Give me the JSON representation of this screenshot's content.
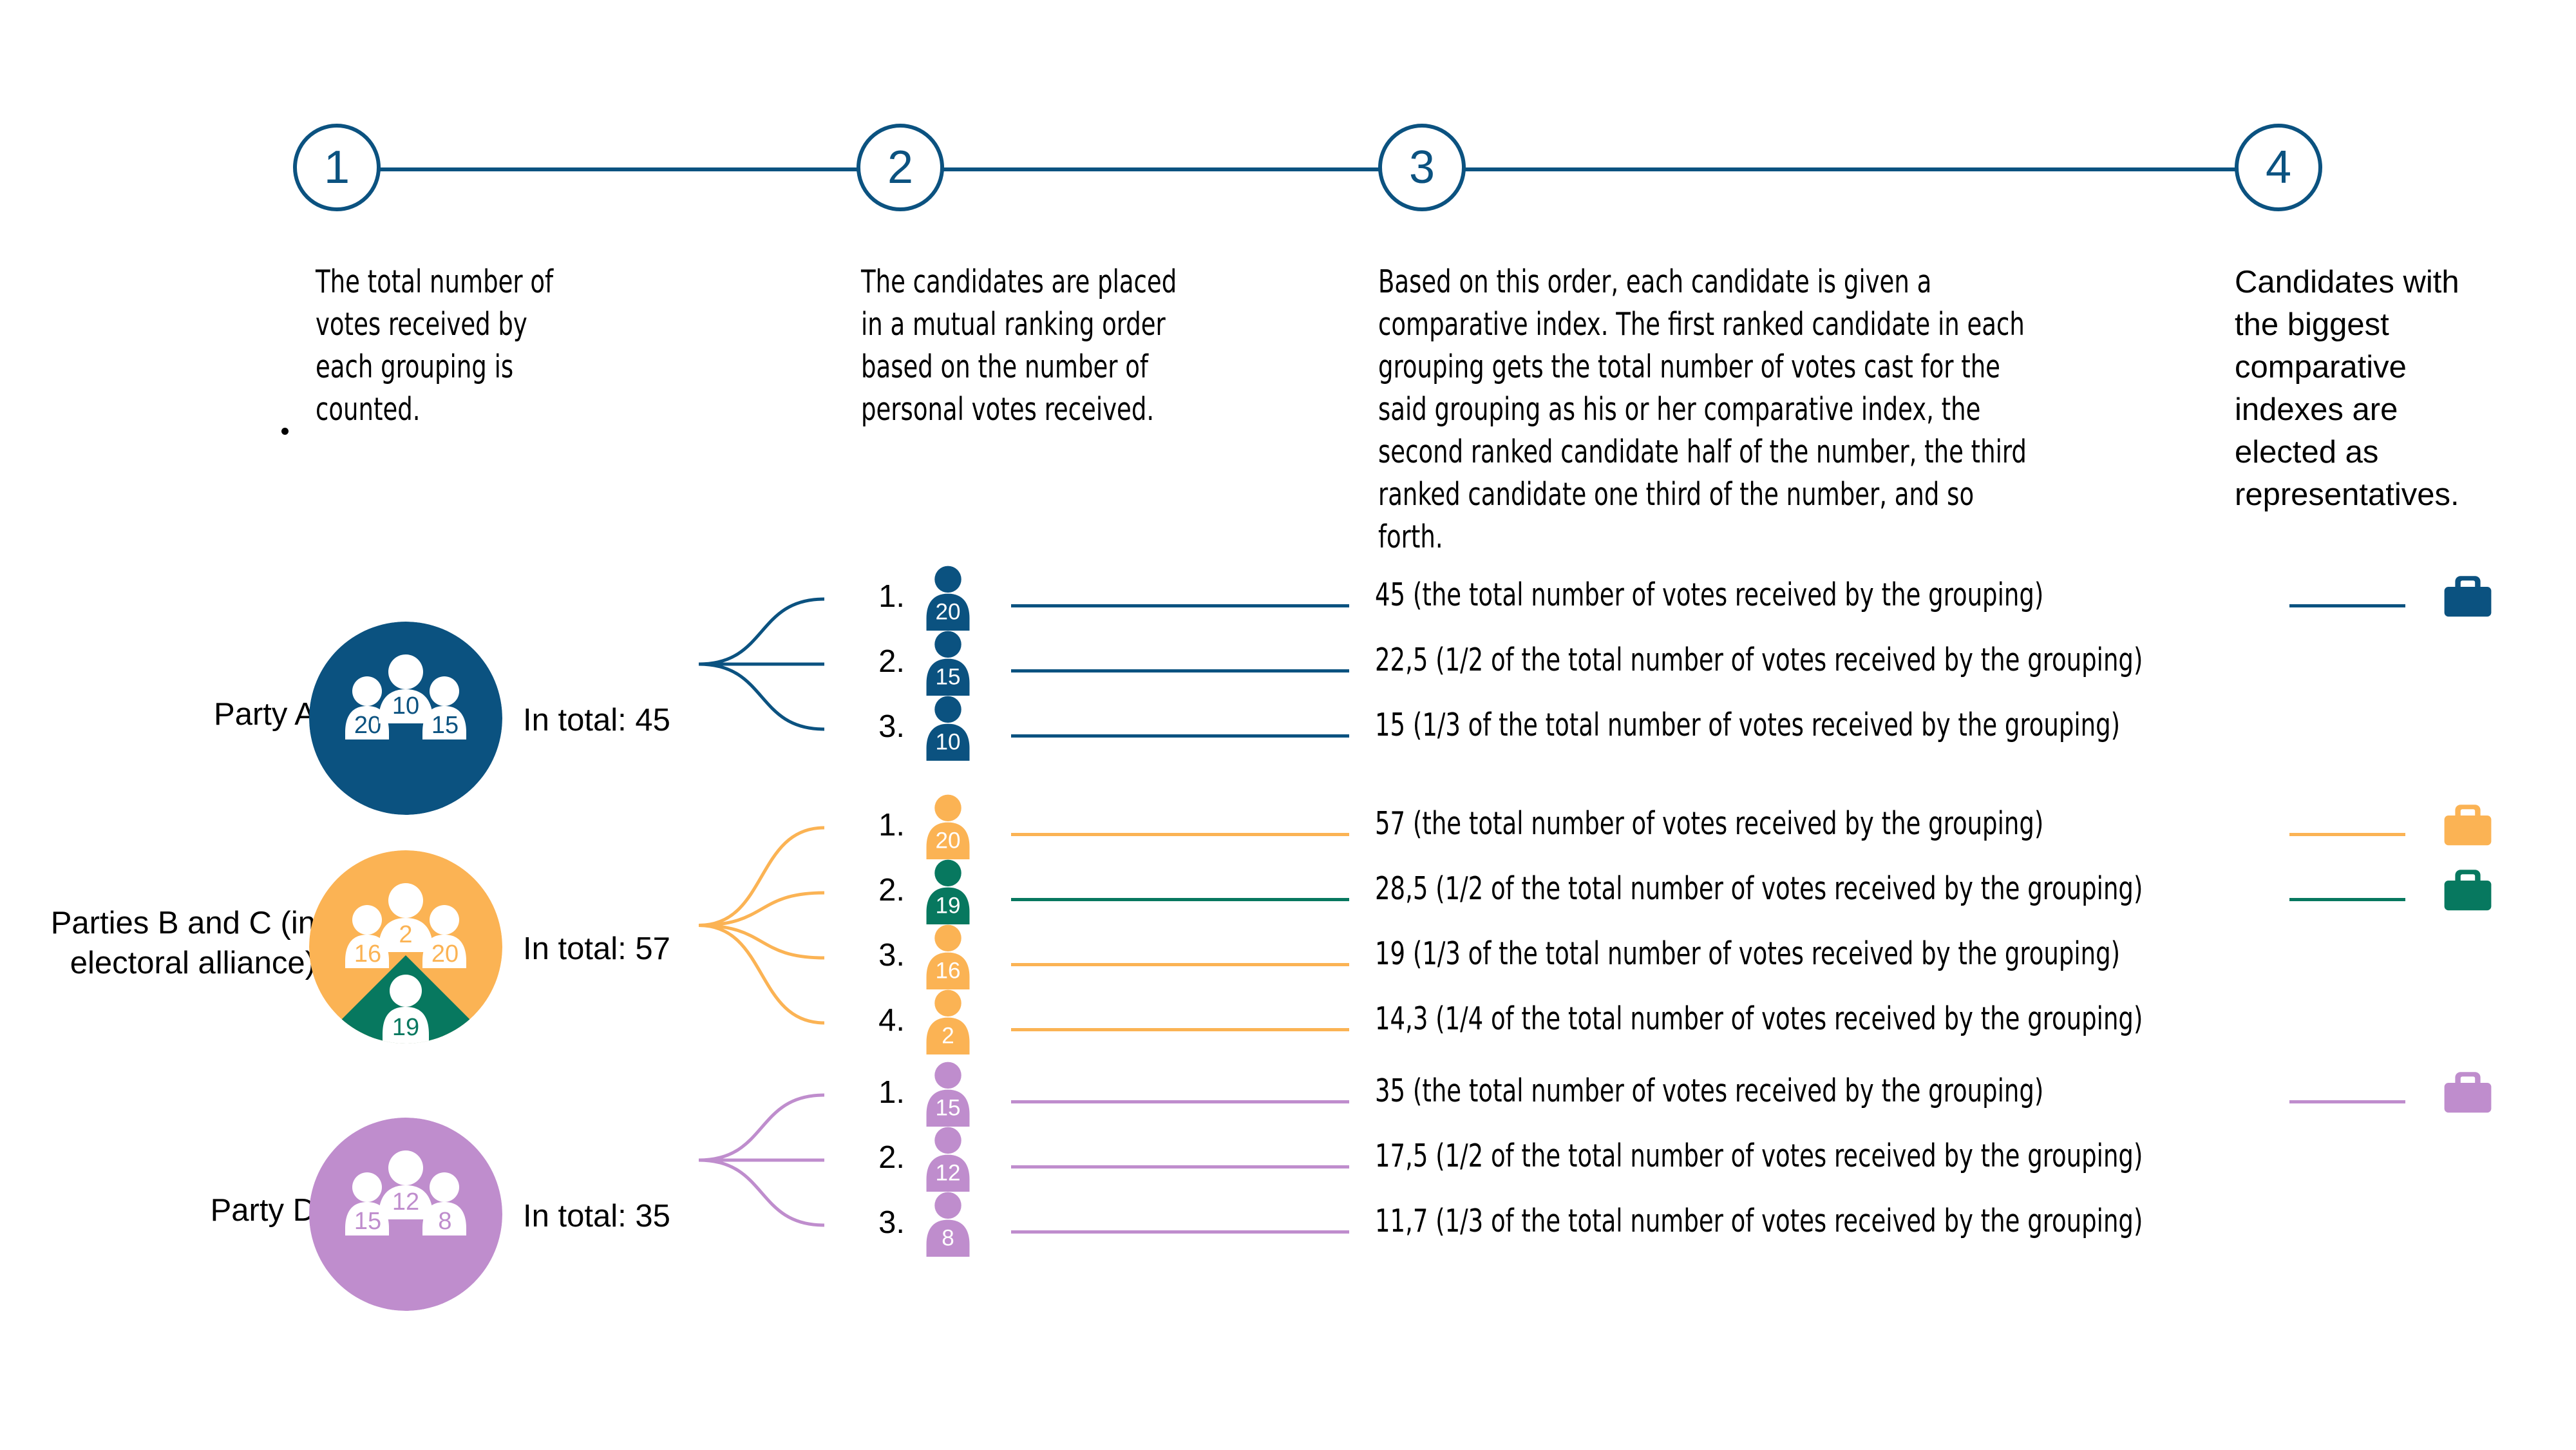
{
  "colors": {
    "blue": "#0b5280",
    "orange": "#fbb354",
    "green": "#07785f",
    "purple": "#bf8dcd",
    "text": "#000000",
    "white": "#ffffff"
  },
  "steps": [
    {
      "number": "1",
      "text": "The total number of votes received by each grouping is counted."
    },
    {
      "number": "2",
      "text": "The candidates are placed in a mutual ranking order based on the number of personal votes received."
    },
    {
      "number": "3",
      "text": "Based on this order, each candidate is given a comparative index. The first ranked candidate in each grouping gets the total number of votes cast for the said grouping as his or her comparative index, the second ranked candidate half of the number, the third ranked candidate one third of the number, and so forth."
    },
    {
      "number": "4",
      "text": "Candidates with the biggest comparative indexes are elected as representatives."
    }
  ],
  "stray_dot": ".",
  "groups": [
    {
      "label": "Party A",
      "color": "#0b5280",
      "total_label": "In total: 45",
      "total": 45,
      "circle_people": [
        {
          "value": "20",
          "color": "#0b5280"
        },
        {
          "value": "10",
          "color": "#0b5280"
        },
        {
          "value": "15",
          "color": "#0b5280"
        }
      ],
      "ranked": [
        {
          "rank": "1.",
          "votes": "20",
          "color": "#0b5280",
          "index": "45 (the total number of votes received by the grouping)",
          "elected": true
        },
        {
          "rank": "2.",
          "votes": "15",
          "color": "#0b5280",
          "index": "22,5 (1/2 of the total number of votes received by the grouping)",
          "elected": false
        },
        {
          "rank": "3.",
          "votes": "10",
          "color": "#0b5280",
          "index": "15 (1/3 of the total number of votes received by the grouping)",
          "elected": false
        }
      ],
      "briefcases": [
        {
          "color": "#0b5280",
          "row": 0
        }
      ]
    },
    {
      "label": "Parties B and C (in electoral alliance)",
      "color": "#fbb354",
      "secondary_color": "#07785f",
      "total_label": "In total: 57",
      "total": 57,
      "circle_people": [
        {
          "value": "16",
          "color": "#fbb354"
        },
        {
          "value": "2",
          "color": "#fbb354"
        },
        {
          "value": "20",
          "color": "#fbb354"
        },
        {
          "value": "19",
          "color": "#07785f"
        }
      ],
      "ranked": [
        {
          "rank": "1.",
          "votes": "20",
          "color": "#fbb354",
          "index": "57 (the total number of votes received by the grouping)",
          "elected": true
        },
        {
          "rank": "2.",
          "votes": "19",
          "color": "#07785f",
          "index": "28,5 (1/2 of the total number of votes received by the grouping)",
          "elected": true
        },
        {
          "rank": "3.",
          "votes": "16",
          "color": "#fbb354",
          "index": "19 (1/3 of the total number of votes received by the grouping)",
          "elected": false
        },
        {
          "rank": "4.",
          "votes": "2",
          "color": "#fbb354",
          "index": "14,3 (1/4 of the total number of votes received by the grouping)",
          "elected": false
        }
      ],
      "briefcases": [
        {
          "color": "#fbb354",
          "row": 0
        },
        {
          "color": "#07785f",
          "row": 1
        }
      ]
    },
    {
      "label": "Party D",
      "color": "#bf8dcd",
      "total_label": "In total: 35",
      "total": 35,
      "circle_people": [
        {
          "value": "15",
          "color": "#bf8dcd"
        },
        {
          "value": "12",
          "color": "#bf8dcd"
        },
        {
          "value": "8",
          "color": "#bf8dcd"
        }
      ],
      "ranked": [
        {
          "rank": "1.",
          "votes": "15",
          "color": "#bf8dcd",
          "index": "35 (the total number of votes received by the grouping)",
          "elected": true
        },
        {
          "rank": "2.",
          "votes": "12",
          "color": "#bf8dcd",
          "index": "17,5 (1/2 of the total number of votes received by the grouping)",
          "elected": false
        },
        {
          "rank": "3.",
          "votes": "8",
          "color": "#bf8dcd",
          "index": "11,7 (1/3 of the total number of votes received by the grouping)",
          "elected": false
        }
      ],
      "briefcases": [
        {
          "color": "#bf8dcd",
          "row": 0
        }
      ]
    }
  ]
}
